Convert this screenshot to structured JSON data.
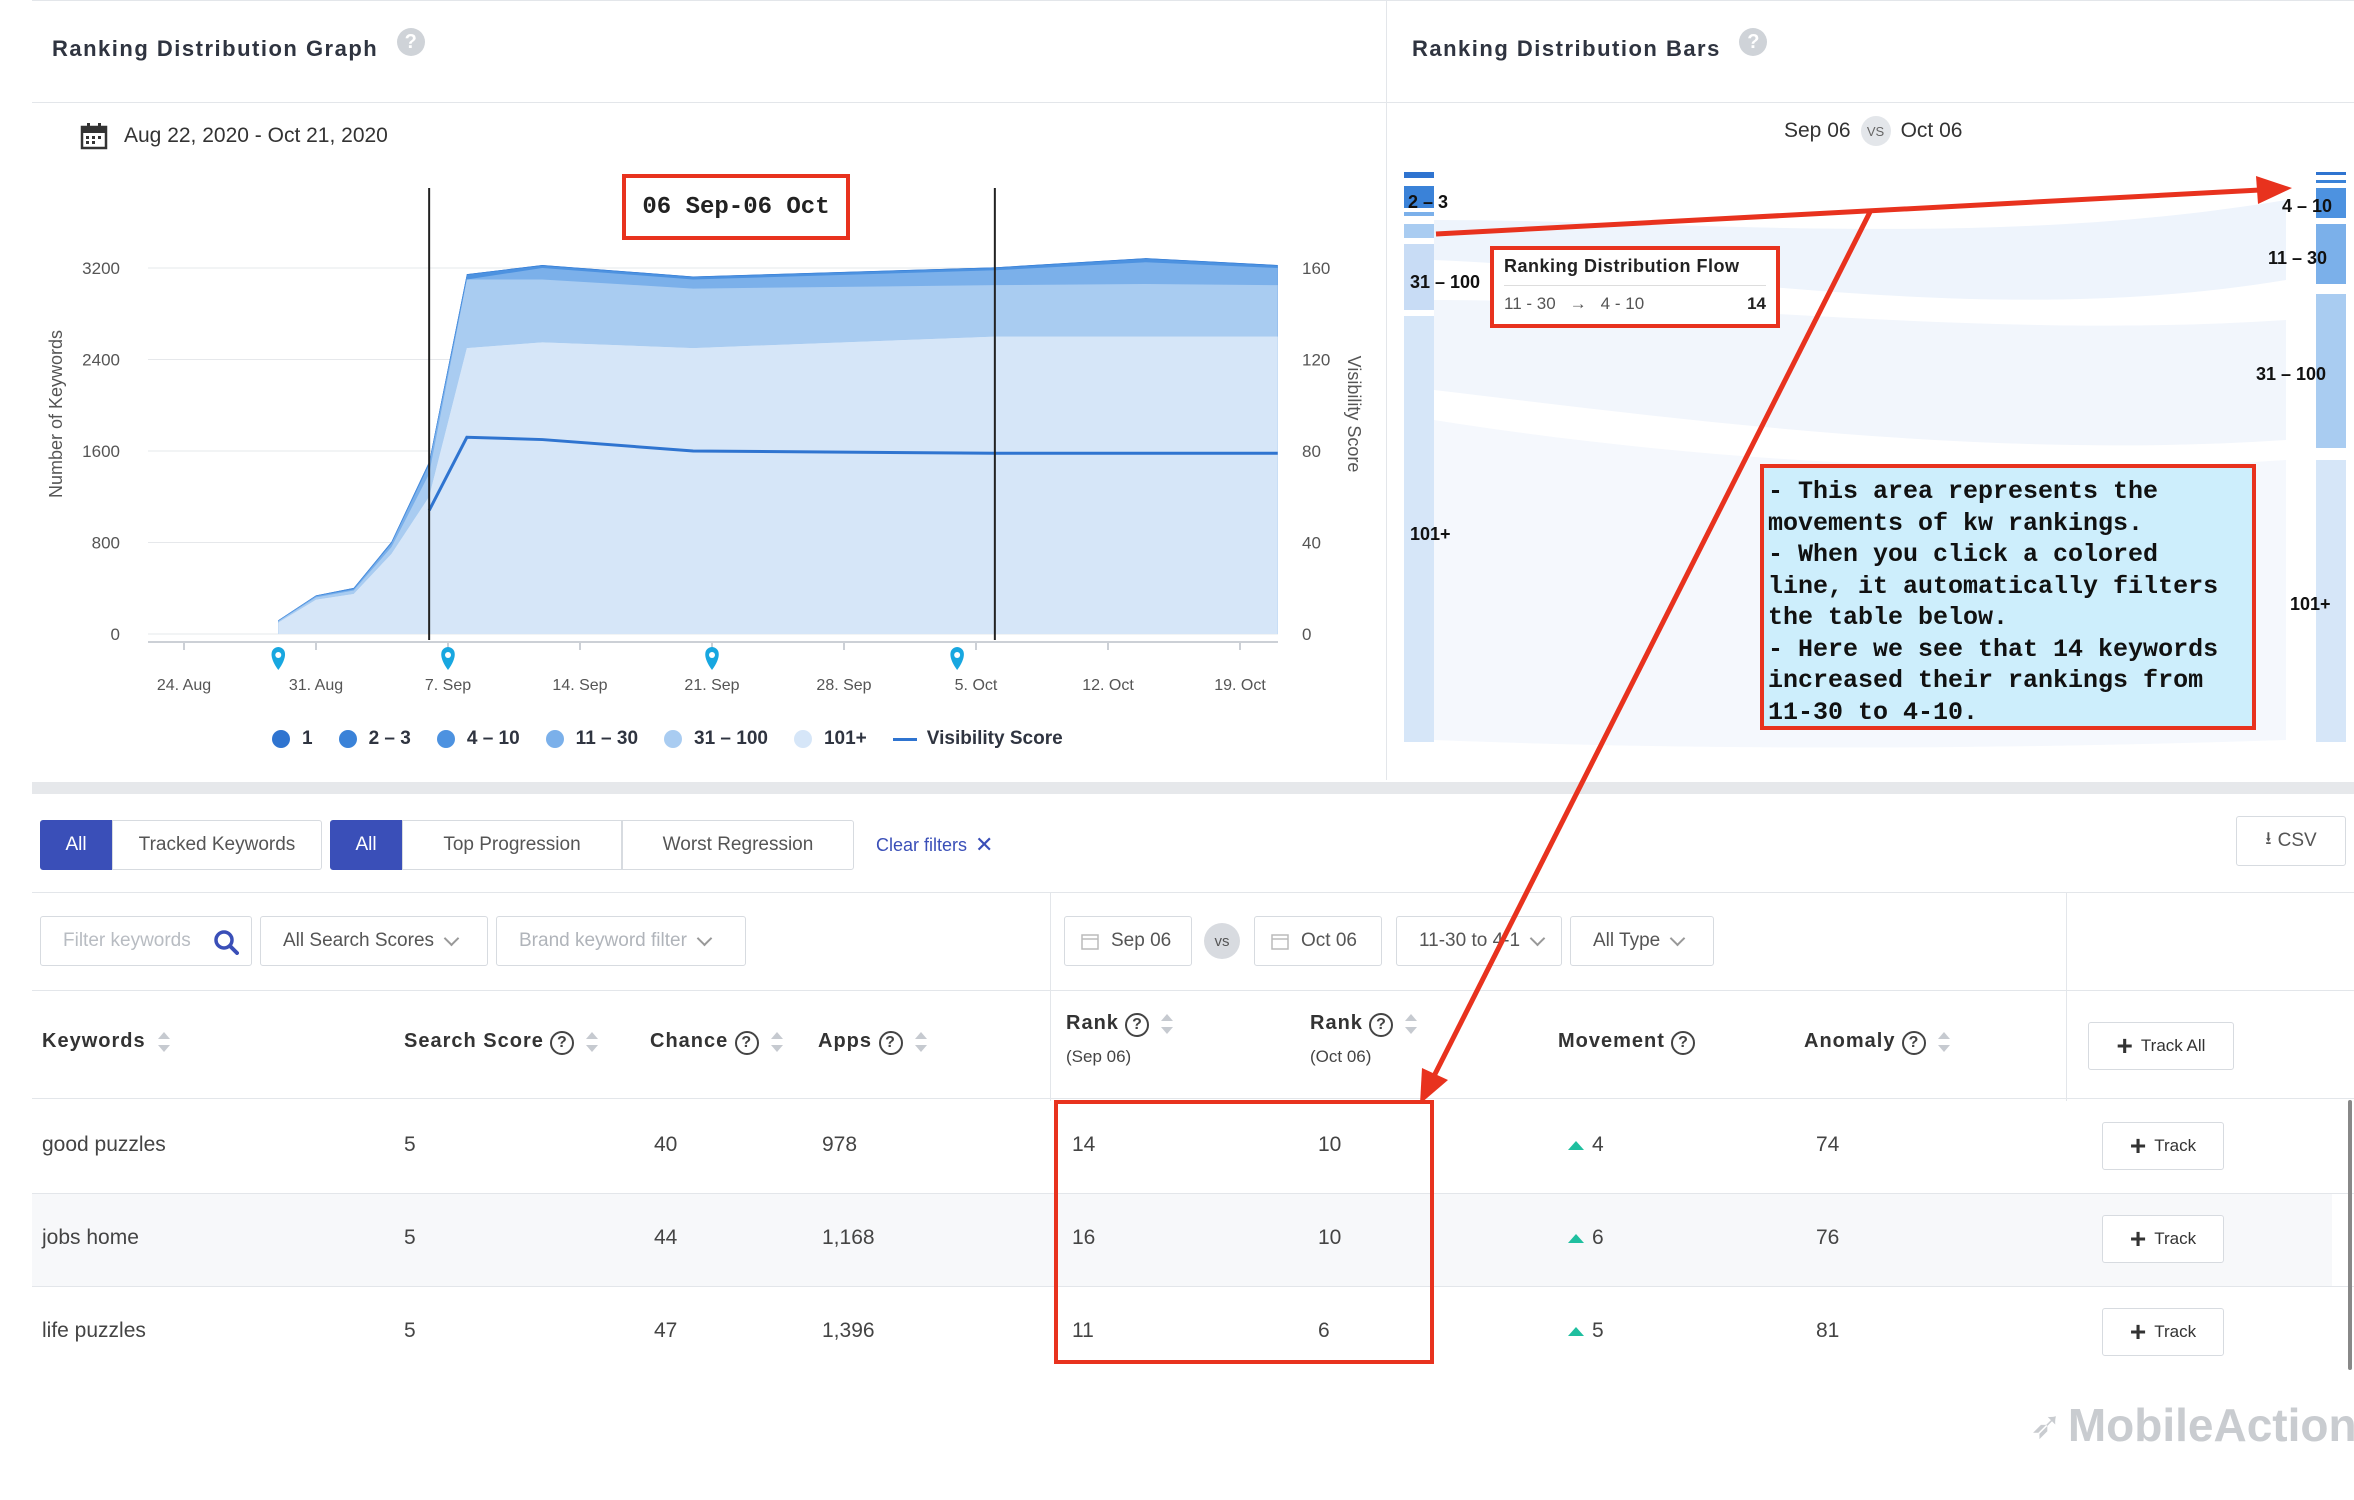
{
  "graph_panel": {
    "title": "Ranking Distribution Graph",
    "help": "?",
    "date_range": "Aug 22, 2020 - Oct 21, 2020"
  },
  "bars_panel": {
    "title": "Ranking Distribution Bars",
    "help": "?",
    "date_from": "Sep 06",
    "vs": "VS",
    "date_to": "Oct 06",
    "left_labels": [
      "2 – 3",
      "31 – 100",
      "101+"
    ],
    "right_labels": [
      "4 – 10",
      "11 – 30",
      "31 – 100",
      "101+"
    ],
    "flow_tooltip": {
      "title": "Ranking Distribution Flow",
      "from": "11 - 30",
      "arrow": "→",
      "to": "4 - 10",
      "count": "14"
    }
  },
  "annotations": {
    "date_box": "06 Sep-06 Oct",
    "explanation": "- This area represents the movements of kw rankings.\n- When you click a colored line, it automatically filters the table below.\n- Here we see that 14 keywords increased their rankings from 11-30 to 4-10."
  },
  "chart_data": {
    "type": "area",
    "ylabel": "Number of Keywords",
    "y2label": "Visibility Score",
    "yticks": [
      "3200",
      "2400",
      "1600",
      "800",
      "0"
    ],
    "y2ticks": [
      "160",
      "120",
      "80",
      "40",
      "0"
    ],
    "ylim": [
      0,
      3200
    ],
    "y2lim": [
      0,
      160
    ],
    "xticks": [
      "24. Aug",
      "31. Aug",
      "7. Sep",
      "14. Sep",
      "21. Sep",
      "28. Sep",
      "5. Oct",
      "12. Oct",
      "19. Oct"
    ],
    "x": [
      "Aug 29",
      "Aug 31",
      "Sep 2",
      "Sep 4",
      "Sep 6",
      "Sep 8",
      "Sep 12",
      "Sep 20",
      "Oct 6",
      "Oct 14",
      "Oct 21"
    ],
    "series": [
      {
        "name": "101+",
        "color": "#d6e6f8",
        "values": [
          100,
          300,
          350,
          700,
          1200,
          2500,
          2550,
          2500,
          2600,
          2600,
          2600
        ]
      },
      {
        "name": "31 - 100",
        "color": "#a9ccf1",
        "values": [
          110,
          320,
          380,
          760,
          1400,
          3100,
          3100,
          3020,
          3050,
          3060,
          3050
        ]
      },
      {
        "name": "11 - 30",
        "color": "#7bb0ea",
        "values": [
          115,
          330,
          390,
          790,
          1480,
          3100,
          3200,
          3100,
          3180,
          3250,
          3200
        ]
      },
      {
        "name": "4 - 10",
        "color": "#4d92e0",
        "values": [
          118,
          335,
          400,
          800,
          1500,
          3140,
          3220,
          3120,
          3200,
          3280,
          3220
        ]
      },
      {
        "name": "2 - 3",
        "color": "#3a82d8",
        "values": [
          119,
          337,
          402,
          805,
          1505,
          3145,
          3225,
          3125,
          3205,
          3285,
          3225
        ]
      },
      {
        "name": "1",
        "color": "#2f74d0",
        "values": [
          120,
          338,
          403,
          806,
          1506,
          3146,
          3226,
          3126,
          3206,
          3286,
          3226
        ]
      }
    ],
    "line": {
      "name": "Visibility Score",
      "color": "#2f74d0",
      "values": [
        null,
        null,
        null,
        null,
        54,
        86,
        85,
        80,
        79,
        79,
        79
      ]
    },
    "legend": [
      "1",
      "2 – 3",
      "4 – 10",
      "11 – 30",
      "31 – 100",
      "101+",
      "Visibility Score"
    ],
    "legend_colors": [
      "#2f74d0",
      "#3a82d8",
      "#4d92e0",
      "#7bb0ea",
      "#a9ccf1",
      "#d6e6f8",
      "#2f74d0"
    ]
  },
  "filters": {
    "group1": [
      "All",
      "Tracked Keywords"
    ],
    "group2": [
      "All",
      "Top Progression",
      "Worst Regression"
    ],
    "clear": "Clear filters",
    "csv": "CSV",
    "keyword_placeholder": "Filter keywords",
    "search_scores": "All Search Scores",
    "brand": "Brand keyword filter",
    "date1": "Sep 06",
    "vs": "vs",
    "date2": "Oct 06",
    "movement": "11-30 to 4-1",
    "type": "All Type"
  },
  "table": {
    "headers": {
      "keywords": "Keywords",
      "search_score": "Search Score",
      "chance": "Chance",
      "apps": "Apps",
      "rank1": "Rank",
      "rank1_sub": "(Sep 06)",
      "rank2": "Rank",
      "rank2_sub": "(Oct 06)",
      "movement": "Movement",
      "anomaly": "Anomaly",
      "track_all": "Track All"
    },
    "rows": [
      {
        "keyword": "good puzzles",
        "score": "5",
        "chance": "40",
        "apps": "978",
        "rank1": "14",
        "rank2": "10",
        "movement": "4",
        "anomaly": "74",
        "track": "Track"
      },
      {
        "keyword": "jobs home",
        "score": "5",
        "chance": "44",
        "apps": "1,168",
        "rank1": "16",
        "rank2": "10",
        "movement": "6",
        "anomaly": "76",
        "track": "Track"
      },
      {
        "keyword": "life puzzles",
        "score": "5",
        "chance": "47",
        "apps": "1,396",
        "rank1": "11",
        "rank2": "6",
        "movement": "5",
        "anomaly": "81",
        "track": "Track"
      }
    ]
  },
  "watermark": "MobileAction"
}
